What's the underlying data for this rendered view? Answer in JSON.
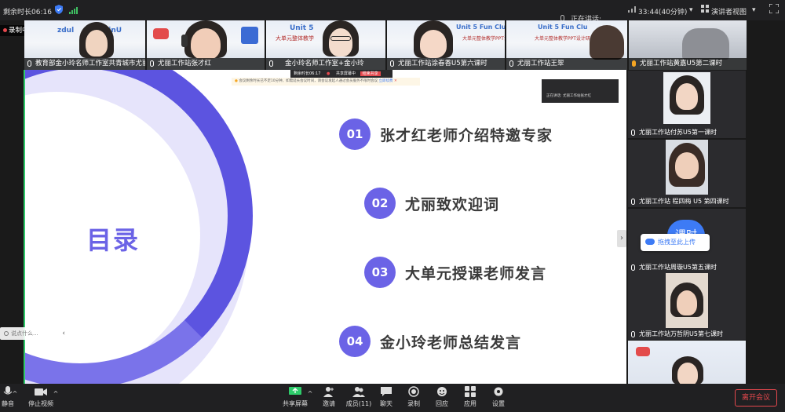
{
  "topbar": {
    "remaining": "剩余时长06:16",
    "speaking_label": "正在讲话:",
    "time_info": "33:44(40分钟)",
    "view_label": "演讲者视图"
  },
  "recording": {
    "label": "录制中"
  },
  "top_tiles": [
    {
      "caption": "教育部金小玲名师工作室共青城市尤丽",
      "slide_title": "zdul",
      "slide_title2": "tinU"
    },
    {
      "caption": "尤丽工作站张才红",
      "slide_title": "",
      "slide_title2": ""
    },
    {
      "caption": "金小玲名师工作室+金小玲",
      "slide_title": "Unit 5",
      "slide_title2": "大单元整体教学"
    },
    {
      "caption": "尤丽工作站涂春香U5第六课时",
      "slide_title": "Unit 5 Fun Clubs",
      "slide_title2": "大单元整体教学PPT设计研讨会"
    },
    {
      "caption": "尤丽工作站王翠",
      "slide_title": "Unit 5 Fun Clu",
      "slide_title2": "大单元整体教学PPT设计研"
    },
    {
      "caption": "尤丽工作站黄嘉U5第二课时",
      "slide_title": "",
      "slide_title2": ""
    }
  ],
  "slide": {
    "title": "目录",
    "items": [
      {
        "num": "01",
        "text": "张才红老师介绍特邀专家"
      },
      {
        "num": "02",
        "text": "尤丽致欢迎词"
      },
      {
        "num": "03",
        "text": "大单元授课老师发言"
      },
      {
        "num": "04",
        "text": "金小玲老师总结发言"
      }
    ],
    "inner_bar": {
      "timer": "剩余时长06:17",
      "status": "共享屏幕中",
      "stop": "结束共享",
      "notice": "会议剩余时长已不足10分钟，如需延长会议时间，请会议发起人通过会员服务不限时会议",
      "notice_link": "立即续费",
      "mini_speaking": "正在讲话: 尤丽工作站张才红"
    }
  },
  "right_tiles": [
    {
      "caption": "尤丽工作站付苏U5第一课时"
    },
    {
      "caption": "尤丽工作站 程四梅 U5 第四课时"
    },
    {
      "caption": "尤丽工作站周璇U5第五课时"
    },
    {
      "caption": "尤丽工作站万哲阴U5第七课时"
    },
    {
      "caption": ""
    }
  ],
  "upload_popup": {
    "label": "拖拽至此上传",
    "logo_text": "课时"
  },
  "chat_hint": {
    "label": "说点什么..."
  },
  "toolbar": {
    "mute": "静音",
    "stop_video": "停止视频",
    "share": "共享屏幕",
    "invite": "邀请",
    "members": "成员(11)",
    "chat": "聊天",
    "record": "录制",
    "interact": "回应",
    "apps": "应用",
    "settings": "设置",
    "leave": "离开会议"
  },
  "colors": {
    "accent": "#6b63e6",
    "green": "#2ecb6a",
    "leave": "#e5484d"
  }
}
